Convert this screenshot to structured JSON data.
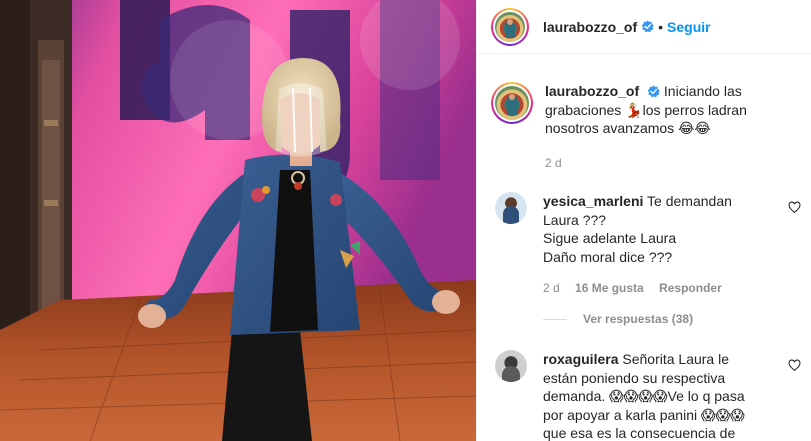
{
  "post": {
    "username": "laurabozzo_of",
    "follow_label": "Seguir",
    "dot": "•",
    "caption_text": "Iniciando las grabaciones 💃🏼los perros ladran nosotros avanzamos 😂😂",
    "caption_age": "2 d"
  },
  "comments": [
    {
      "username": "yesica_marleni",
      "text": "Te demandan Laura ???\nSigue adelante Laura\nDaño moral dice ???",
      "age": "2 d",
      "likes": "16 Me gusta",
      "reply_label": "Responder",
      "view_replies": "Ver respuestas (38)"
    },
    {
      "username": "roxaguilera",
      "text": "Señorita Laura le están poniendo su respectiva demanda. 😱😱😱😱Ve lo q pasa por apoyar a karla panini 😱😱😱 que esa es la consecuencia de"
    }
  ],
  "icons": {
    "verified": "verified-badge-icon",
    "heart": "heart-outline-icon"
  },
  "colors": {
    "link": "#0095f6",
    "verified": "#3897f0",
    "muted": "#8e8e8e"
  }
}
